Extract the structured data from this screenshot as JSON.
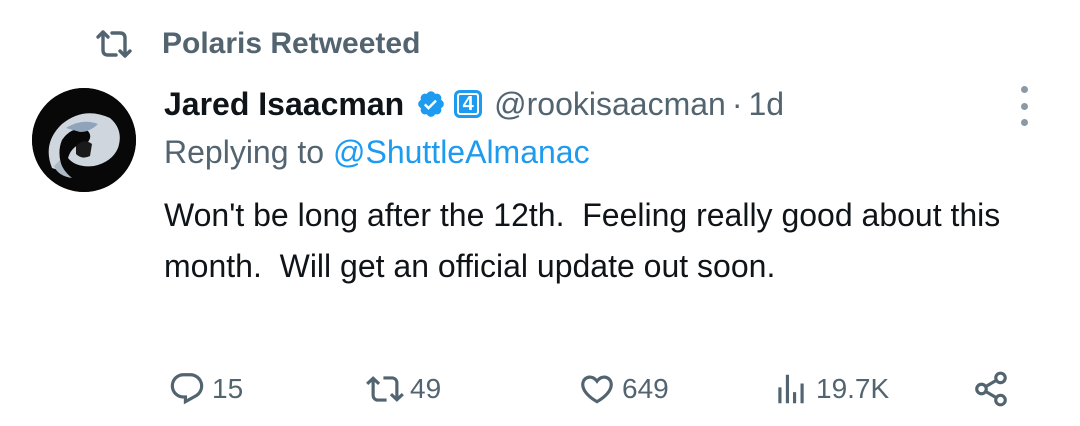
{
  "retweet": {
    "label": "Polaris Retweeted",
    "icon": "retweet-icon"
  },
  "author": {
    "name": "Jared Isaacman",
    "affiliate_badge": "4",
    "handle": "@rookisaacman",
    "separator": "·",
    "time": "1d"
  },
  "reply": {
    "prefix": "Replying to",
    "mention": "@ShuttleAlmanac"
  },
  "tweet": {
    "text": "Won't be long after the 12th.  Feeling really good about this month.  Will get an official update out soon."
  },
  "actions": {
    "replies": "15",
    "retweets": "49",
    "likes": "649",
    "views": "19.7K"
  },
  "colors": {
    "accent": "#1d9bf0",
    "secondary_text": "#536471",
    "primary_text": "#0f1419"
  }
}
